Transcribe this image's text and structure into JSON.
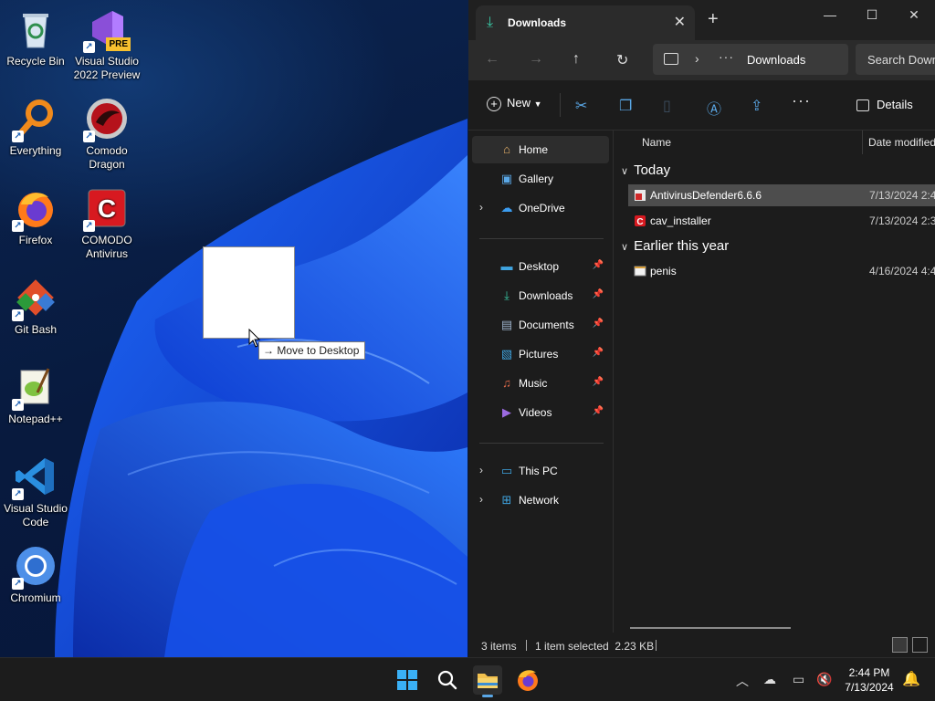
{
  "desktop": {
    "icons": [
      {
        "label": "Recycle Bin",
        "name": "recycle-bin-icon"
      },
      {
        "label": "Visual Studio 2022 Preview",
        "name": "visual-studio-preview-icon",
        "badge": "PRE"
      },
      {
        "label": "Everything",
        "name": "everything-icon"
      },
      {
        "label": "Comodo Dragon",
        "name": "comodo-dragon-icon"
      },
      {
        "label": "Firefox",
        "name": "firefox-icon"
      },
      {
        "label": "COMODO Antivirus",
        "name": "comodo-antivirus-icon"
      },
      {
        "label": "Git Bash",
        "name": "git-bash-icon"
      },
      {
        "label": "Notepad++",
        "name": "notepad-plus-plus-icon"
      },
      {
        "label": "Visual Studio Code",
        "name": "vscode-icon"
      },
      {
        "label": "Chromium",
        "name": "chromium-icon"
      }
    ],
    "drag_tooltip": "Move to Desktop"
  },
  "explorer": {
    "tab_title": "Downloads",
    "window_controls": {
      "minimize": "—",
      "maximize": "☐",
      "close": "✕"
    },
    "address": {
      "location": "Downloads"
    },
    "search": {
      "placeholder": "Search Downloads"
    },
    "toolbar": {
      "new_label": "New",
      "details_label": "Details"
    },
    "nav": {
      "home": "Home",
      "gallery": "Gallery",
      "onedrive": "OneDrive",
      "desktop": "Desktop",
      "downloads": "Downloads",
      "documents": "Documents",
      "pictures": "Pictures",
      "music": "Music",
      "videos": "Videos",
      "this_pc": "This PC",
      "network": "Network"
    },
    "columns": {
      "name": "Name",
      "date": "Date modified"
    },
    "groups": {
      "today": "Today",
      "earlier": "Earlier this year"
    },
    "files": [
      {
        "name": "AntivirusDefender6.6.6",
        "date": "7/13/2024 2:4",
        "selected": true
      },
      {
        "name": "cav_installer",
        "date": "7/13/2024 2:3",
        "selected": false
      },
      {
        "name": "penis",
        "date": "4/16/2024 4:4",
        "selected": false
      }
    ],
    "status": {
      "count": "3 items",
      "selection": "1 item selected  2.23 KB"
    }
  },
  "taskbar": {
    "time": "2:44 PM",
    "date": "7/13/2024"
  },
  "colors": {
    "accent": "#5aa7e6",
    "explorer_bg": "#1c1c1c",
    "selected_row": "#4d4d4d"
  }
}
